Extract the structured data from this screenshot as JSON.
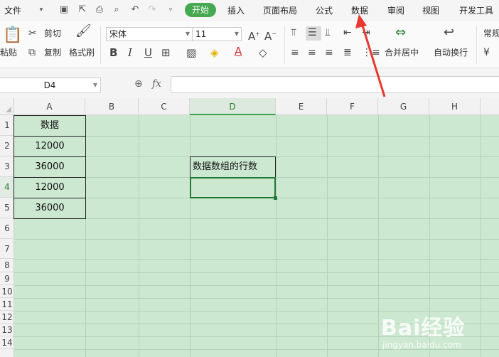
{
  "menu": {
    "file": "文件",
    "tabs": [
      "开始",
      "插入",
      "页面布局",
      "公式",
      "数据",
      "审阅",
      "视图",
      "开发工具"
    ]
  },
  "ribbon": {
    "paste": "粘贴",
    "cut": "剪切",
    "copy": "复制",
    "format_painter": "格式刷",
    "font_name": "宋体",
    "font_size": "11",
    "merge_center": "合并居中",
    "wrap_text": "自动换行",
    "number_format": "常规"
  },
  "formula_bar": {
    "cell_ref": "D4",
    "fx": "fx",
    "content": ""
  },
  "sheet": {
    "columns": [
      "A",
      "B",
      "C",
      "D",
      "E",
      "F",
      "G",
      "H"
    ],
    "rows": [
      "1",
      "2",
      "3",
      "4",
      "5",
      "6",
      "7",
      "8",
      "9",
      "10",
      "11",
      "12",
      "13",
      "14"
    ],
    "selected_column": "D",
    "selected_row": "4",
    "a1": "数据",
    "a2": "12000",
    "a3": "36000",
    "a4": "12000",
    "a5": "36000",
    "d3": "数据数组的行数",
    "grid_color": "#cde8d1"
  },
  "watermark": {
    "brand": "Bai经验",
    "url": "jingyan.baidu.com"
  },
  "colors": {
    "accent": "#46a851",
    "arrow": "#e8382f"
  }
}
